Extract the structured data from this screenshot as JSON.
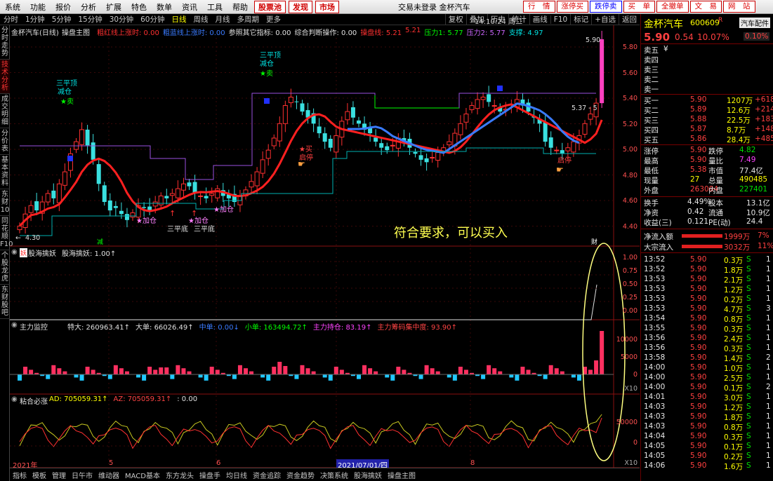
{
  "menu": [
    "系统",
    "功能",
    "报价",
    "分析",
    "扩展",
    "特色",
    "数单",
    "资讯",
    "工具",
    "帮助"
  ],
  "menu_red": [
    "股票池",
    "发现",
    "市场"
  ],
  "window_title": "交易未登录  金杯汽车",
  "top_buttons": [
    "行　情",
    "涨停买",
    "跌停卖",
    "买　单",
    "全撤单",
    "文　易",
    "网　站"
  ],
  "time": "14:10:24 周二",
  "periods": [
    "分时",
    "1分钟",
    "5分钟",
    "15分钟",
    "30分钟",
    "60分钟",
    "日线",
    "周线",
    "月线",
    "多周期",
    "更多"
  ],
  "active_period": "日线",
  "tools": [
    "复权",
    "叠加",
    "历史",
    "统计",
    "画线",
    "F10",
    "标记",
    "+自选",
    "返回"
  ],
  "left_tabs": [
    "分时走势",
    "技术分析",
    "成交明细",
    "分价表",
    "基本资料",
    "东财10",
    "同花顺F10",
    "个股龙虎",
    "东财股吧"
  ],
  "main_legend": {
    "title": "金杯汽车(日线)",
    "formula": "操盘主图",
    "items": [
      {
        "text": "粗红线上涨时: 0.00",
        "color": "#ff3030"
      },
      {
        "text": "粗蓝线上涨时: 0.00",
        "color": "#3a7bff"
      },
      {
        "text": "参照其它指标: 0.00",
        "color": "#e0e0e0"
      },
      {
        "text": "综合判断操作: 0.00",
        "color": "#e0e0e0"
      },
      {
        "text": "操盘线: 5.21",
        "color": "#ff3030"
      },
      {
        "text": "5.21",
        "color": "#ff3030"
      },
      {
        "text": "压力1: 5.77",
        "color": "#00ff00"
      },
      {
        "text": "压力2: 5.77",
        "color": "#cc66ff"
      },
      {
        "text": "支撑: 4.97",
        "color": "#00e0e0"
      }
    ]
  },
  "annotations": {
    "high_price": "5.90",
    "last_price": "5.37 - 5",
    "low_price": "4.30",
    "three_top_1": "三平顶",
    "reduce_1": "减仓",
    "sell_1": "卖",
    "three_top_2": "三平顶",
    "reduce_2": "减仓",
    "sell_2": "卖",
    "buy_1": "买",
    "start_1": "启停",
    "start_2": "启停",
    "add_1": "加仓",
    "add_2": "加仓",
    "add_3": "加仓",
    "three_bottom_1": "三平底",
    "three_bottom_2": "三平底",
    "reduce_mark": "减",
    "cai": "财",
    "overlay_text": "符合要求，可以买入"
  },
  "price_axis": [
    "5.80",
    "5.60",
    "5.40",
    "5.20",
    "5.00",
    "4.80",
    "4.60",
    "4.40"
  ],
  "ind1": {
    "title": "妖",
    "name": "股海擒妖",
    "value": "股海擒妖: 1.00↑",
    "axis": [
      "1.00",
      "0.75",
      "0.50",
      "0.25",
      "0.00"
    ]
  },
  "ind2": {
    "title": "主力监控",
    "items": [
      {
        "text": "特大: 260963.41↑",
        "color": "#e0e0e0"
      },
      {
        "text": "大单: 66026.49↑",
        "color": "#e0e0e0"
      },
      {
        "text": "中单: 0.00↓",
        "color": "#3a7bff"
      },
      {
        "text": "小单: 163494.72↑",
        "color": "#00ff00"
      },
      {
        "text": "主力持仓: 83.19↑",
        "color": "#ff44ff"
      },
      {
        "text": "主力筹码集中度: 93.90↑",
        "color": "#ff4444"
      }
    ],
    "axis": [
      "10000",
      "5000",
      "0"
    ],
    "unit": "X10"
  },
  "ind3": {
    "title": "粘合必涨",
    "items": [
      {
        "text": "AD: 705059.31↑",
        "color": "#ffff00"
      },
      {
        "text": "AZ: 705059.31↑",
        "color": "#ff4444"
      },
      {
        "text": ": 0.00",
        "color": "#e0e0e0"
      }
    ],
    "axis": [
      "50000",
      "0"
    ],
    "unit": "X10"
  },
  "xaxis": {
    "labels": [
      "2021年",
      "5",
      "6",
      "2021/07/01/四",
      "8"
    ]
  },
  "bottom_tabs": [
    "指标",
    "模板",
    "管理",
    "日午市",
    "维动器",
    "MACD基本",
    "东方龙头",
    "操盘手",
    "均日线",
    "资金追踪",
    "资金趋势",
    "决策系统",
    "股海擒妖",
    "操盘主图"
  ],
  "right": {
    "name": "金杯汽车",
    "code": "600609",
    "code_suffix": "R",
    "industry": "汽车配件",
    "price": "5.90",
    "change": "0.54",
    "pct": "10.07%",
    "pct2": "0.10%",
    "sell_levels": [
      {
        "label": "卖五",
        "price": "¥",
        "vol": "",
        "chg": ""
      },
      {
        "label": "卖四",
        "price": "",
        "vol": "",
        "chg": ""
      },
      {
        "label": "卖三",
        "price": "",
        "vol": "",
        "chg": ""
      },
      {
        "label": "卖二",
        "price": "",
        "vol": "",
        "chg": ""
      },
      {
        "label": "卖一",
        "price": "",
        "vol": "",
        "chg": ""
      }
    ],
    "buy_levels": [
      {
        "label": "买一",
        "price": "5.90",
        "vol": "1207万",
        "chg": "+618"
      },
      {
        "label": "买二",
        "price": "5.89",
        "vol": "12.6万",
        "chg": "+214"
      },
      {
        "label": "买三",
        "price": "5.88",
        "vol": "22.5万",
        "chg": "+183"
      },
      {
        "label": "买四",
        "price": "5.87",
        "vol": "8.7万",
        "chg": "+148"
      },
      {
        "label": "买五",
        "price": "5.86",
        "vol": "28.4万",
        "chg": "+485"
      }
    ],
    "stats": [
      {
        "l1": "涨停",
        "v1": "5.90",
        "c1": "red",
        "l2": "跌停",
        "v2": "4.82",
        "c2": "green"
      },
      {
        "l1": "最高",
        "v1": "5.90",
        "c1": "red",
        "l2": "量比",
        "v2": "7.49",
        "c2": "magenta"
      },
      {
        "l1": "最低",
        "v1": "5.38",
        "c1": "red",
        "l2": "市值",
        "v2": "77.4亿",
        "c2": "white"
      },
      {
        "l1": "现量",
        "v1": "27",
        "c1": "yellow",
        "l2": "总量",
        "v2": "490485",
        "c2": "yellow"
      },
      {
        "l1": "外盘",
        "v1": "263084",
        "c1": "red",
        "l2": "内盘",
        "v2": "227401",
        "c2": "green"
      }
    ],
    "stats2": [
      {
        "l1": "换手",
        "v1": "4.49%",
        "l2": "股本",
        "v2": "13.1亿"
      },
      {
        "l1": "净资",
        "v1": "0.42",
        "l2": "流通",
        "v2": "10.9亿"
      },
      {
        "l1": "收益(三)",
        "v1": "0.121",
        "l2": "PE(动)",
        "v2": "24.4"
      }
    ],
    "flows": [
      {
        "label": "净流入额",
        "value": "1999万",
        "pct": "7%"
      },
      {
        "label": "大宗流入",
        "value": "3032万",
        "pct": "11%"
      }
    ],
    "ticks": [
      {
        "t": "13:52",
        "p": "5.90",
        "v": "0.3万",
        "s": "S",
        "n": "1"
      },
      {
        "t": "13:52",
        "p": "5.90",
        "v": "1.8万",
        "s": "S",
        "n": "1"
      },
      {
        "t": "13:53",
        "p": "5.90",
        "v": "2.1万",
        "s": "S",
        "n": "1"
      },
      {
        "t": "13:53",
        "p": "5.90",
        "v": "1.2万",
        "s": "S",
        "n": "1"
      },
      {
        "t": "13:53",
        "p": "5.90",
        "v": "0.2万",
        "s": "S",
        "n": "1"
      },
      {
        "t": "13:53",
        "p": "5.90",
        "v": "4.7万",
        "s": "S",
        "n": "3"
      },
      {
        "t": "13:54",
        "p": "5.90",
        "v": "0.8万",
        "s": "S",
        "n": "1"
      },
      {
        "t": "13:55",
        "p": "5.90",
        "v": "0.3万",
        "s": "S",
        "n": "1"
      },
      {
        "t": "13:56",
        "p": "5.90",
        "v": "2.4万",
        "s": "S",
        "n": "1"
      },
      {
        "t": "13:56",
        "p": "5.90",
        "v": "0.3万",
        "s": "S",
        "n": "1"
      },
      {
        "t": "13:58",
        "p": "5.90",
        "v": "1.4万",
        "s": "S",
        "n": "2"
      },
      {
        "t": "14:00",
        "p": "5.90",
        "v": "1.0万",
        "s": "S",
        "n": "1"
      },
      {
        "t": "14:00",
        "p": "5.90",
        "v": "2.5万",
        "s": "S",
        "n": "1"
      },
      {
        "t": "14:00",
        "p": "5.90",
        "v": "0.1万",
        "s": "S",
        "n": "2"
      },
      {
        "t": "14:01",
        "p": "5.90",
        "v": "3.0万",
        "s": "S",
        "n": "1"
      },
      {
        "t": "14:03",
        "p": "5.90",
        "v": "1.2万",
        "s": "S",
        "n": "1"
      },
      {
        "t": "14:03",
        "p": "5.90",
        "v": "1.8万",
        "s": "S",
        "n": "1"
      },
      {
        "t": "14:03",
        "p": "5.90",
        "v": "0.8万",
        "s": "S",
        "n": "1"
      },
      {
        "t": "14:04",
        "p": "5.90",
        "v": "0.3万",
        "s": "S",
        "n": "1"
      },
      {
        "t": "14:05",
        "p": "5.90",
        "v": "0.1万",
        "s": "S",
        "n": "1"
      },
      {
        "t": "14:05",
        "p": "5.90",
        "v": "0.2万",
        "s": "S",
        "n": "1"
      },
      {
        "t": "14:06",
        "p": "5.90",
        "v": "1.6万",
        "s": "S",
        "n": "1"
      }
    ]
  }
}
